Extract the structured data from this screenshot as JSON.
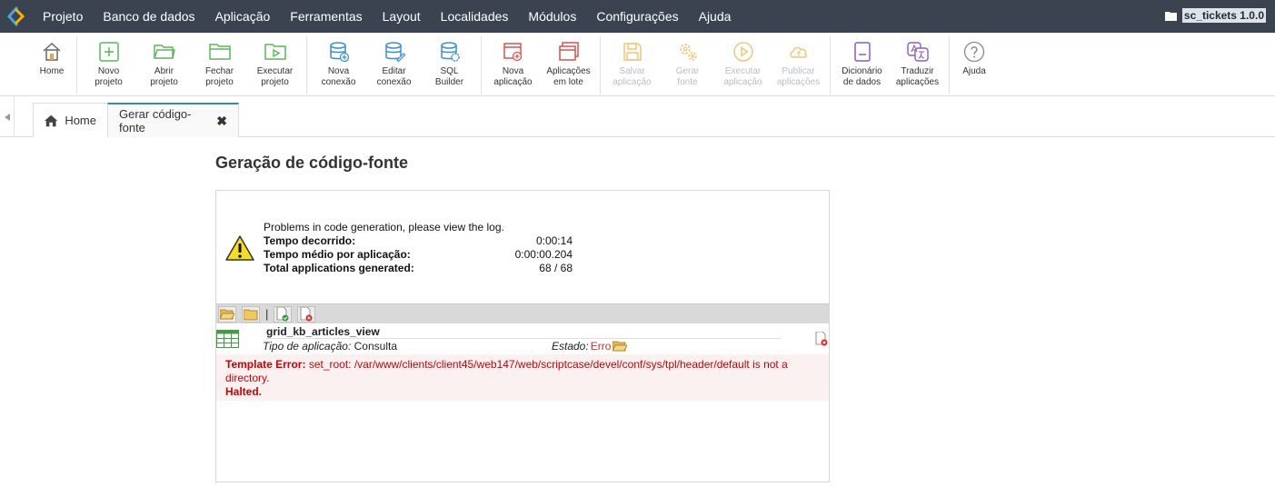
{
  "menu": {
    "items": [
      "Projeto",
      "Banco de dados",
      "Aplicação",
      "Ferramentas",
      "Layout",
      "Localidades",
      "Módulos",
      "Configurações",
      "Ajuda"
    ],
    "project_name": "sc_tickets 1.0.0"
  },
  "toolbar": {
    "home": "Home",
    "novo_projeto": [
      "Novo",
      "projeto"
    ],
    "abrir_projeto": [
      "Abrir",
      "projeto"
    ],
    "fechar_projeto": [
      "Fechar",
      "projeto"
    ],
    "executar_projeto": [
      "Executar",
      "projeto"
    ],
    "nova_conexao": [
      "Nova",
      "conexão"
    ],
    "editar_conexao": [
      "Editar",
      "conexão"
    ],
    "sql_builder": [
      "SQL",
      "Builder"
    ],
    "nova_aplicacao": [
      "Nova",
      "aplicação"
    ],
    "aplicacoes_lote": [
      "Aplicações",
      "em lote"
    ],
    "salvar_aplicacao": [
      "Salvar",
      "aplicação"
    ],
    "gerar_fonte": [
      "Gerar",
      "fonte"
    ],
    "executar_aplicacao": [
      "Executar",
      "aplicação"
    ],
    "publicar_aplicacoes": [
      "Publicar",
      "aplicações"
    ],
    "dicionario_dados": [
      "Dicionário",
      "de dados"
    ],
    "traduzir_aplicacoes": [
      "Traduzir",
      "aplicações"
    ],
    "ajuda": "Ajuda"
  },
  "tabs": {
    "home": "Home",
    "active": "Gerar código-fonte"
  },
  "page": {
    "title": "Geração de código-fonte"
  },
  "summary": {
    "message": "Problems in code generation, please view the log.",
    "elapsed_label": "Tempo decorrido:",
    "elapsed_value": "0:00:14",
    "avg_label": "Tempo médio por aplicação:",
    "avg_value": "0:00:00.204",
    "total_label": "Total applications generated:",
    "total_value": "68 / 68"
  },
  "log": {
    "separator": "|",
    "app_name": "grid_kb_articles_view",
    "type_label": "Tipo de aplicação:",
    "type_value": "Consulta",
    "state_label": "Estado:",
    "state_value": "Erro",
    "error_label": "Template Error:",
    "error_message": "set_root: /var/www/clients/client45/web147/web/scriptcase/devel/conf/sys/tpl/header/default is not a directory.",
    "halted": "Halted."
  }
}
